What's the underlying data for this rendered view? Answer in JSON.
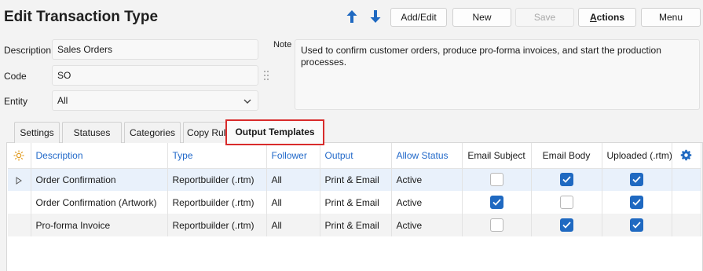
{
  "header": {
    "title": "Edit Transaction Type",
    "buttons": {
      "add_edit": "Add/Edit",
      "new": "New",
      "save": "Save",
      "actions_underlined": "A",
      "actions_rest": "ctions",
      "menu": "Menu"
    }
  },
  "form": {
    "description_label": "Description",
    "description_value": "Sales Orders",
    "code_label": "Code",
    "code_value": "SO",
    "entity_label": "Entity",
    "entity_value": "All",
    "note_label": "Note",
    "note_value": "Used to confirm customer orders, produce pro-forma invoices, and start the production processes."
  },
  "tabs": {
    "settings": "Settings",
    "statuses": "Statuses",
    "categories": "Categories",
    "copy_rules": "Copy Rules",
    "output_templates": "Output Templates",
    "active": "Output Templates"
  },
  "table": {
    "columns": {
      "description": "Description",
      "type": "Type",
      "follower": "Follower",
      "output": "Output",
      "allow_status": "Allow Status",
      "email_subject": "Email Subject",
      "email_body": "Email Body",
      "uploaded": "Uploaded (.rtm)"
    },
    "rows": [
      {
        "description": "Order Confirmation",
        "type": "Reportbuilder (.rtm)",
        "follower": "All",
        "output": "Print & Email",
        "allow_status": "Active",
        "email_subject": false,
        "email_body": true,
        "uploaded": true
      },
      {
        "description": "Order Confirmation (Artwork)",
        "type": "Reportbuilder (.rtm)",
        "follower": "All",
        "output": "Print & Email",
        "allow_status": "Active",
        "email_subject": true,
        "email_body": false,
        "uploaded": true
      },
      {
        "description": "Pro-forma Invoice",
        "type": "Reportbuilder (.rtm)",
        "follower": "All",
        "output": "Print & Email",
        "allow_status": "Active",
        "email_subject": false,
        "email_body": true,
        "uploaded": true
      }
    ]
  },
  "colors": {
    "accent": "#1f69c1",
    "link": "#2269c9",
    "active_tab_outline": "#d82b2b",
    "selected_row": "#e9f1fb",
    "sun_icon": "#e09a1d"
  },
  "icons": {
    "move_up": "arrow-up-icon",
    "move_down": "arrow-down-icon",
    "column_settings": "gear-icon",
    "row_options": "sun-icon",
    "row_pointer": "triangle-right-icon",
    "entity_dropdown": "chevron-down-icon",
    "resize_grip": "grip-dots-icon"
  }
}
